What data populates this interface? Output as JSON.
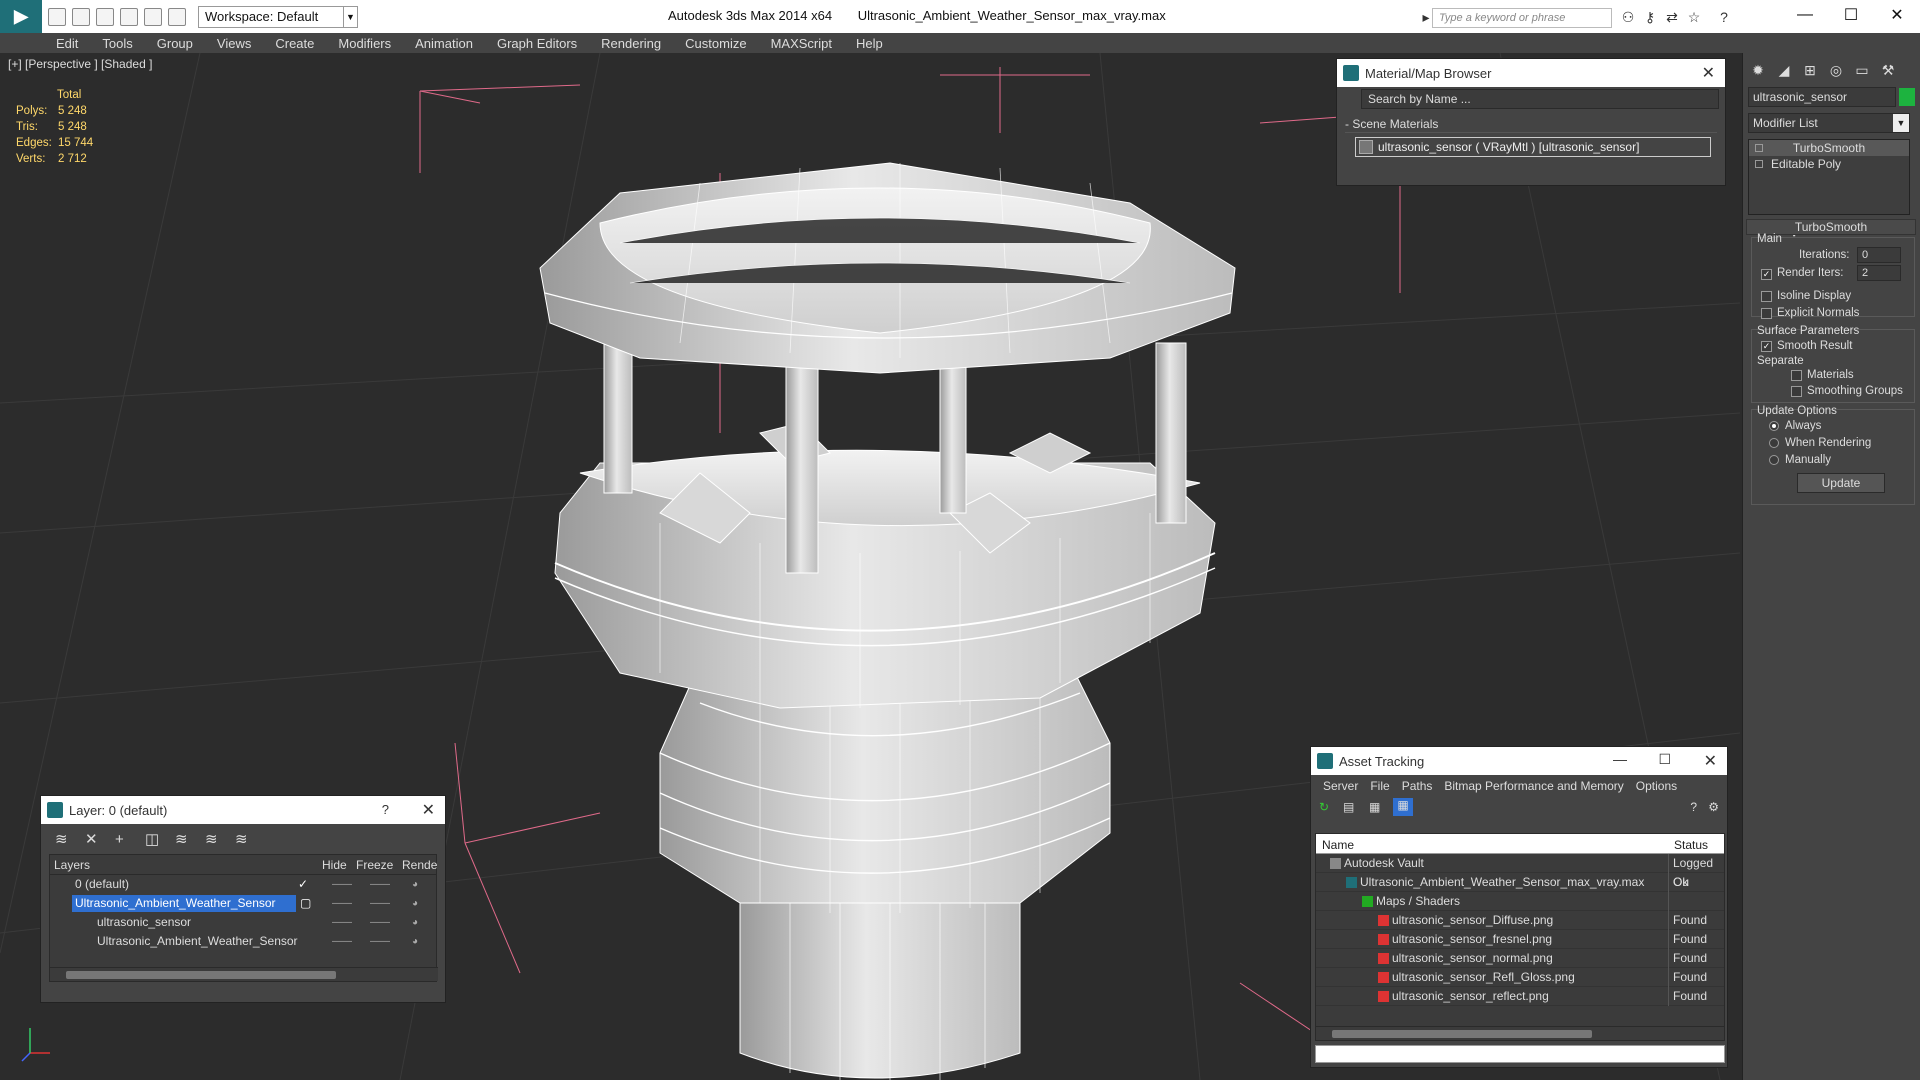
{
  "titlebar": {
    "app_name": "Autodesk 3ds Max  2014 x64",
    "file_name": "Ultrasonic_Ambient_Weather_Sensor_max_vray.max",
    "workspace_label": "Workspace: Default",
    "search_placeholder": "Type a keyword or phrase"
  },
  "menu": [
    "Edit",
    "Tools",
    "Group",
    "Views",
    "Create",
    "Modifiers",
    "Animation",
    "Graph Editors",
    "Rendering",
    "Customize",
    "MAXScript",
    "Help"
  ],
  "viewport": {
    "label": "[+] [Perspective ] [Shaded ]",
    "stats": {
      "header": "Total",
      "rows": [
        {
          "k": "Polys:",
          "v": "5 248"
        },
        {
          "k": "Tris:",
          "v": "5 248"
        },
        {
          "k": "Edges:",
          "v": "15 744"
        },
        {
          "k": "Verts:",
          "v": "2 712"
        }
      ]
    }
  },
  "material_browser": {
    "title": "Material/Map Browser",
    "search_placeholder": "Search by Name ...",
    "section": "- Scene Materials",
    "item": "ultrasonic_sensor  ( VRayMtl ) [ultrasonic_sensor]"
  },
  "command_panel": {
    "object_name": "ultrasonic_sensor",
    "object_color": "#1db33f",
    "modifier_list": "Modifier List",
    "stack": [
      "TurboSmooth",
      "Editable Poly"
    ],
    "rollout_title": "TurboSmooth",
    "main_label": "Main",
    "iterations_label": "Iterations:",
    "iterations_value": "0",
    "render_iters_label": "Render Iters:",
    "render_iters_value": "2",
    "render_iters_checked": true,
    "isoline_label": "Isoline Display",
    "explicit_normals_label": "Explicit Normals",
    "surface_params_label": "Surface Parameters",
    "smooth_result_label": "Smooth Result",
    "separate_label": "Separate",
    "materials_label": "Materials",
    "smoothing_groups_label": "Smoothing Groups",
    "update_options_label": "Update Options",
    "always_label": "Always",
    "when_rendering_label": "When Rendering",
    "manually_label": "Manually",
    "update_button": "Update"
  },
  "layer_panel": {
    "title": "Layer: 0 (default)",
    "help": "?",
    "headers": {
      "layers": "Layers",
      "hide": "Hide",
      "freeze": "Freeze",
      "render": "Rende"
    },
    "rows": [
      {
        "name": "0 (default)",
        "indent": 0,
        "selected": false
      },
      {
        "name": "Ultrasonic_Ambient_Weather_Sensor",
        "indent": 0,
        "selected": true
      },
      {
        "name": "ultrasonic_sensor",
        "indent": 1,
        "selected": false
      },
      {
        "name": "Ultrasonic_Ambient_Weather_Sensor",
        "indent": 1,
        "selected": false
      }
    ]
  },
  "asset_tracking": {
    "title": "Asset Tracking",
    "menu": [
      "Server",
      "File",
      "Paths",
      "Bitmap Performance and Memory",
      "Options"
    ],
    "headers": {
      "name": "Name",
      "status": "Status"
    },
    "rows": [
      {
        "name": "Autodesk Vault",
        "status": "Logged Ou",
        "indent": 0,
        "icon": "vault"
      },
      {
        "name": "Ultrasonic_Ambient_Weather_Sensor_max_vray.max",
        "status": "Ok",
        "indent": 1,
        "icon": "max"
      },
      {
        "name": "Maps / Shaders",
        "status": "",
        "indent": 2,
        "icon": "folder"
      },
      {
        "name": "ultrasonic_sensor_Diffuse.png",
        "status": "Found",
        "indent": 3,
        "icon": "png"
      },
      {
        "name": "ultrasonic_sensor_fresnel.png",
        "status": "Found",
        "indent": 3,
        "icon": "png"
      },
      {
        "name": "ultrasonic_sensor_normal.png",
        "status": "Found",
        "indent": 3,
        "icon": "png"
      },
      {
        "name": "ultrasonic_sensor_Refl_Gloss.png",
        "status": "Found",
        "indent": 3,
        "icon": "png"
      },
      {
        "name": "ultrasonic_sensor_reflect.png",
        "status": "Found",
        "indent": 3,
        "icon": "png"
      }
    ]
  }
}
